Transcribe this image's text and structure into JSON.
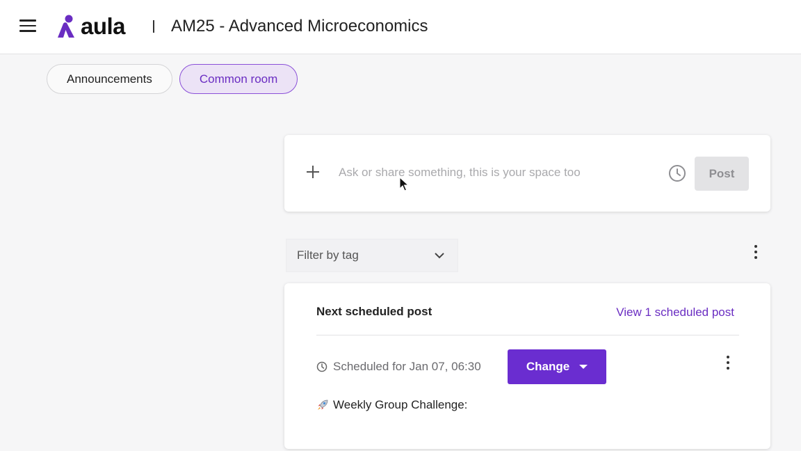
{
  "header": {
    "logo_text": "aula",
    "separator": "|",
    "course_title": "AM25 - Advanced Microeconomics",
    "brand_color": "#6a2dc2"
  },
  "tabs": [
    {
      "label": "Announcements",
      "active": false
    },
    {
      "label": "Common room",
      "active": true
    }
  ],
  "composer": {
    "placeholder": "Ask or share something, this is your space too",
    "post_label": "Post",
    "post_enabled": false
  },
  "filter": {
    "label": "Filter by tag"
  },
  "scheduled": {
    "heading": "Next scheduled post",
    "view_link": "View 1 scheduled post",
    "scheduled_text": "Scheduled for Jan 07, 06:30",
    "change_label": "Change",
    "post_title": "Weekly Group Challenge:"
  },
  "icons": [
    "menu-icon",
    "plus-icon",
    "clock-icon",
    "chevron-down-icon",
    "kebab-icon",
    "rocket-icon",
    "mouse-cursor-icon"
  ]
}
